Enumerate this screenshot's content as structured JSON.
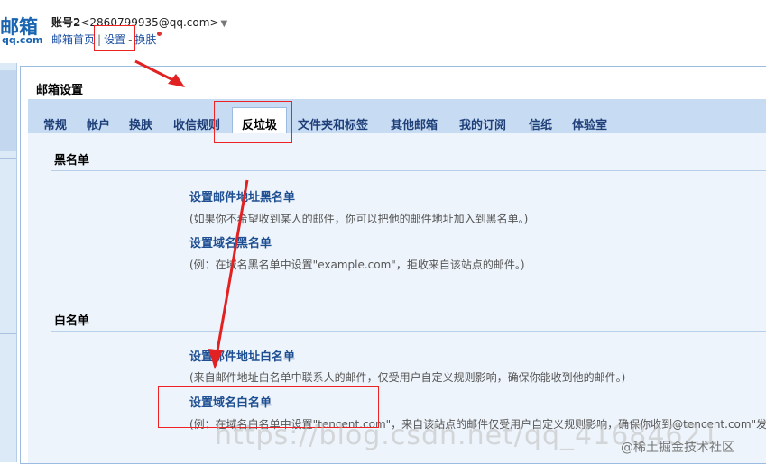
{
  "logo": {
    "main": "邮箱",
    "sub": "qq.com"
  },
  "account": {
    "name": "账号2",
    "email": "<2860799935@qq.com>",
    "caret": "▼"
  },
  "toplinks": {
    "home": "邮箱首页",
    "sep": "|",
    "settings": "设置",
    "sep2": "-",
    "skin": "换肤"
  },
  "panel": {
    "title": "邮箱设置"
  },
  "tabs": [
    {
      "label": "常规"
    },
    {
      "label": "帐户"
    },
    {
      "label": "换肤"
    },
    {
      "label": "收信规则"
    },
    {
      "label": "反垃圾"
    },
    {
      "label": "文件夹和标签"
    },
    {
      "label": "其他邮箱"
    },
    {
      "label": "我的订阅"
    },
    {
      "label": "信纸"
    },
    {
      "label": "体验室"
    }
  ],
  "active_tab": "反垃圾",
  "blacklist": {
    "title": "黑名单",
    "addr_link": "设置邮件地址黑名单",
    "addr_desc": "(如果你不希望收到某人的邮件，你可以把他的邮件地址加入到黑名单。)",
    "domain_link": "设置域名黑名单",
    "domain_desc": "(例：在域名黑名单中设置\"example.com\"，拒收来自该站点的邮件。)"
  },
  "whitelist": {
    "title": "白名单",
    "addr_link": "设置邮件地址白名单",
    "addr_desc": "(来自邮件地址白名单中联系人的邮件，仅受用户自定义规则影响，确保你能收到他的邮件。)",
    "domain_link": "设置域名白名单",
    "domain_desc": "(例：在域名白名单中设置\"tencent.com\"，来自该站点的邮件仅受用户自定义规则影响，确保你收到@tencent.com\"发"
  },
  "watermark": "https://blog.csdn.net/qq_41684621",
  "footer_mark": "@稀土掘金技术社区",
  "colors": {
    "accent": "#1e4f93",
    "tabbar": "#c7dbf3",
    "annotation": "#e22222"
  }
}
